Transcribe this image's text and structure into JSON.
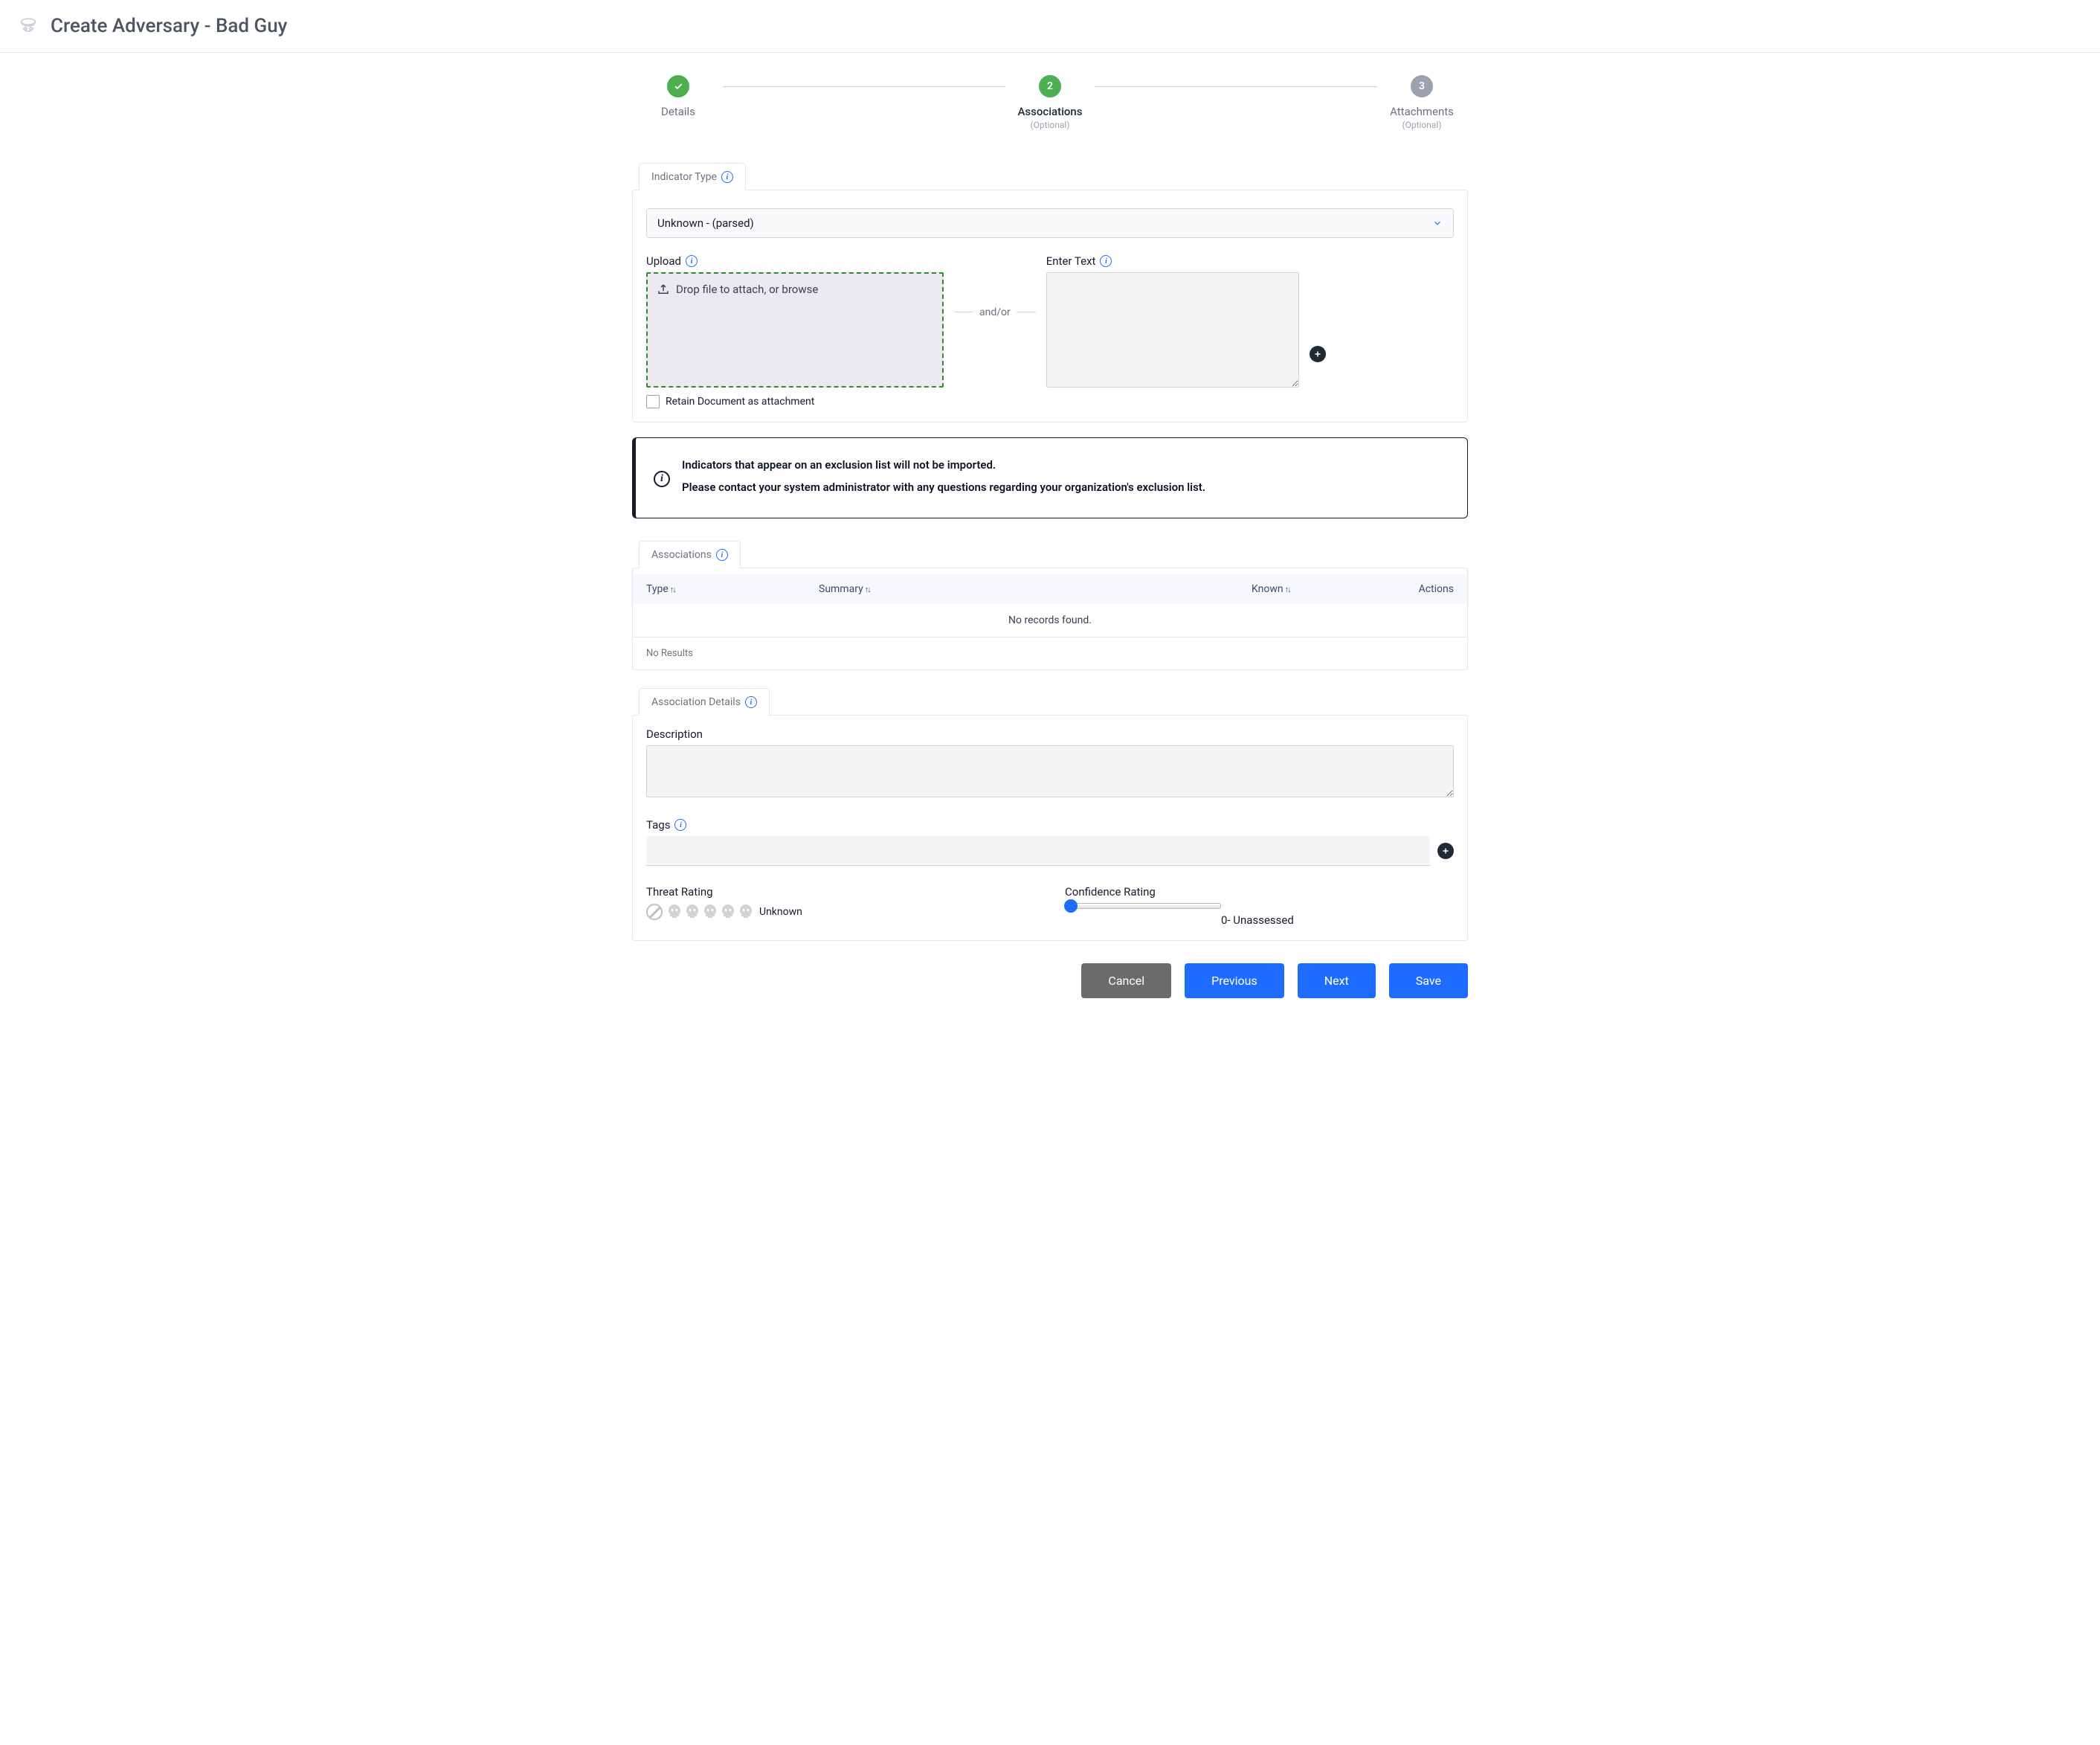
{
  "header": {
    "title": "Create Adversary - Bad Guy"
  },
  "stepper": {
    "step1": {
      "label": "Details"
    },
    "step2": {
      "num": "2",
      "label": "Associations",
      "opt": "(Optional)"
    },
    "step3": {
      "num": "3",
      "label": "Attachments",
      "opt": "(Optional)"
    }
  },
  "indicator": {
    "tab": "Indicator Type",
    "select_value": "Unknown - (parsed)",
    "upload_label": "Upload",
    "drop_text": "Drop file to attach, or browse",
    "retain_label": "Retain Document as attachment",
    "andor": "and/or",
    "enter_text_label": "Enter Text"
  },
  "notice": {
    "line1": "Indicators that appear on an exclusion list will not be imported.",
    "line2": "Please contact your system administrator with any questions regarding your organization's exclusion list."
  },
  "assoc": {
    "tab": "Associations",
    "cols": {
      "type": "Type",
      "summary": "Summary",
      "known": "Known",
      "actions": "Actions"
    },
    "empty": "No records found.",
    "noresults": "No Results"
  },
  "details": {
    "tab": "Association Details",
    "description_label": "Description",
    "tags_label": "Tags",
    "threat_label": "Threat Rating",
    "threat_value": "Unknown",
    "confidence_label": "Confidence Rating",
    "confidence_value": "0- Unassessed"
  },
  "buttons": {
    "cancel": "Cancel",
    "previous": "Previous",
    "next": "Next",
    "save": "Save"
  }
}
